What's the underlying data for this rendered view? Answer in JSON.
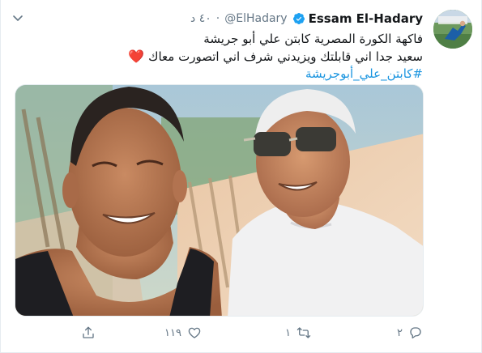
{
  "tweet": {
    "display_name": "Essam El-Hadary",
    "handle": "@ElHadary",
    "separator": "·",
    "time": "٤٠ د",
    "lines": [
      "فاكهة الكورة المصرية كابتن علي أبو جريشة",
      "سعيد جدا اني قابلتك ويزيدني شرف اني اتصورت معاك"
    ],
    "hashtag": "#كابتن_علي_أبوجريشة",
    "heart_emoji": "❤️",
    "verified_color": "#1da1f2",
    "accent_color": "#1b95e0"
  },
  "actions": {
    "reply_count": "٢",
    "retweet_count": "١",
    "like_count": "١١٩",
    "icons": [
      "reply-icon",
      "retweet-icon",
      "like-icon",
      "share-icon"
    ]
  },
  "photo": {
    "content": "selfie-photo"
  }
}
